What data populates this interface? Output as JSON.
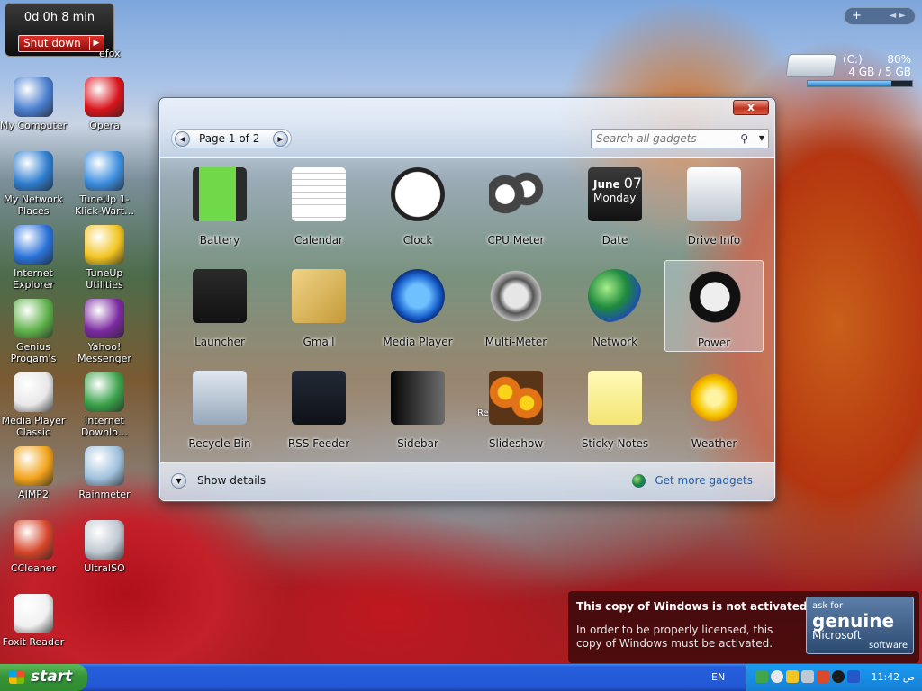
{
  "timer_gadget": {
    "time": "0d 0h 8 min",
    "button": "Shut down"
  },
  "desktop_icons": [
    {
      "label": "My Computer",
      "color": "#4a7fd0"
    },
    {
      "label": "Opera",
      "color": "#d8141c"
    },
    {
      "label": "My Network Places",
      "color": "#2f7ed0"
    },
    {
      "label": "TuneUp 1-Klick-Wart…",
      "color": "#3d8fe0"
    },
    {
      "label": "Internet Explorer",
      "color": "#2a72d9"
    },
    {
      "label": "TuneUp Utilities",
      "color": "#f2c421"
    },
    {
      "label": "Genius Progam's",
      "color": "#5fb24a"
    },
    {
      "label": "Yahoo! Messenger",
      "color": "#7b2aa0"
    },
    {
      "label": "Media Player Classic",
      "color": "#e8e8e8"
    },
    {
      "label": "Internet Downlo…",
      "color": "#3aa24a"
    },
    {
      "label": "AIMP2",
      "color": "#f2a31b"
    },
    {
      "label": "Rainmeter",
      "color": "#9fc1dd"
    },
    {
      "label": "CCleaner",
      "color": "#d6452a"
    },
    {
      "label": "UltraISO",
      "color": "#c0c8d2"
    },
    {
      "label": "Foxit Reader",
      "color": "#f0f0f0"
    }
  ],
  "top_right_partial_label": "efox",
  "gallery": {
    "close": "x",
    "page_text": "Page 1 of 2",
    "search_placeholder": "Search all gadgets",
    "gadgets": [
      {
        "label": "Battery",
        "icon": "battery-icon"
      },
      {
        "label": "Calendar",
        "icon": "calendar-icon"
      },
      {
        "label": "Clock",
        "icon": "clock-icon"
      },
      {
        "label": "CPU Meter",
        "icon": "cpu-meter-icon"
      },
      {
        "label": "Date",
        "icon": "date-icon",
        "date_month": "June",
        "date_day": "07",
        "date_weekday": "Monday"
      },
      {
        "label": "Drive Info",
        "icon": "drive-info-icon"
      },
      {
        "label": "Launcher",
        "icon": "launcher-icon"
      },
      {
        "label": "Gmail",
        "icon": "gmail-icon"
      },
      {
        "label": "Media Player",
        "icon": "media-player-icon"
      },
      {
        "label": "Multi-Meter",
        "icon": "multi-meter-icon"
      },
      {
        "label": "Network",
        "icon": "network-icon"
      },
      {
        "label": "Power",
        "icon": "power-icon"
      },
      {
        "label": "Recycle Bin",
        "icon": "recycle-bin-icon"
      },
      {
        "label": "RSS Feeder",
        "icon": "rss-feeder-icon"
      },
      {
        "label": "Sidebar",
        "icon": "sidebar-icon"
      },
      {
        "label": "Slideshow",
        "icon": "slideshow-icon",
        "overlay": "Recycle Bin"
      },
      {
        "label": "Sticky Notes",
        "icon": "sticky-notes-icon"
      },
      {
        "label": "Weather",
        "icon": "weather-icon"
      }
    ],
    "show_details": "Show details",
    "get_more": "Get more gadgets"
  },
  "drive_gadget": {
    "drive": "(C:)",
    "percent": "80%",
    "size": "4 GB / 5 GB",
    "fill_fraction": 0.8
  },
  "sidebar_control": {
    "plus": "+",
    "arrows": "◄ ►"
  },
  "activation": {
    "title": "This copy of Windows is not activated.",
    "body": "In order to be properly licensed, this copy of Windows must be activated.",
    "badge_top": "ask for",
    "badge_main": "genuine",
    "badge_brand": "Microsoft",
    "badge_sub": "software"
  },
  "taskbar": {
    "start": "start",
    "language": "EN",
    "clock": "11:42 ص"
  }
}
